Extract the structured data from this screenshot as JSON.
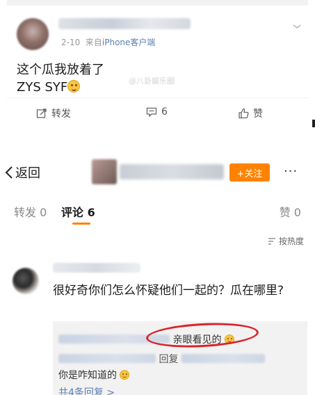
{
  "post": {
    "meta_date": "2-10",
    "meta_source_prefix": "来自",
    "meta_source": "iPhone客户端",
    "text_line1": "这个瓜我放着了",
    "text_line2": "ZYS SYF",
    "watermark": "@八卦娱乐圈",
    "actions": {
      "share": "转发",
      "comment_count": "6",
      "like": "赞"
    }
  },
  "nav": {
    "back_label": "返回",
    "follow_label": "+关注",
    "more_label": "···"
  },
  "tabs": {
    "repost": "转发 0",
    "comment": "评论 6",
    "like": "赞 0"
  },
  "sort_label": "按热度",
  "comment": {
    "text": "很好奇你们怎么怀疑他们一起的？瓜在哪里?",
    "replies": {
      "line1_visible": "亲眼看见的",
      "line2_visible": "回复",
      "line3": "你是咋知道的",
      "more": "共4条回复 >"
    }
  },
  "colors": {
    "accent_orange": "#ff8200",
    "link_blue": "#5b7fb4",
    "highlight_red": "#d9232b"
  }
}
